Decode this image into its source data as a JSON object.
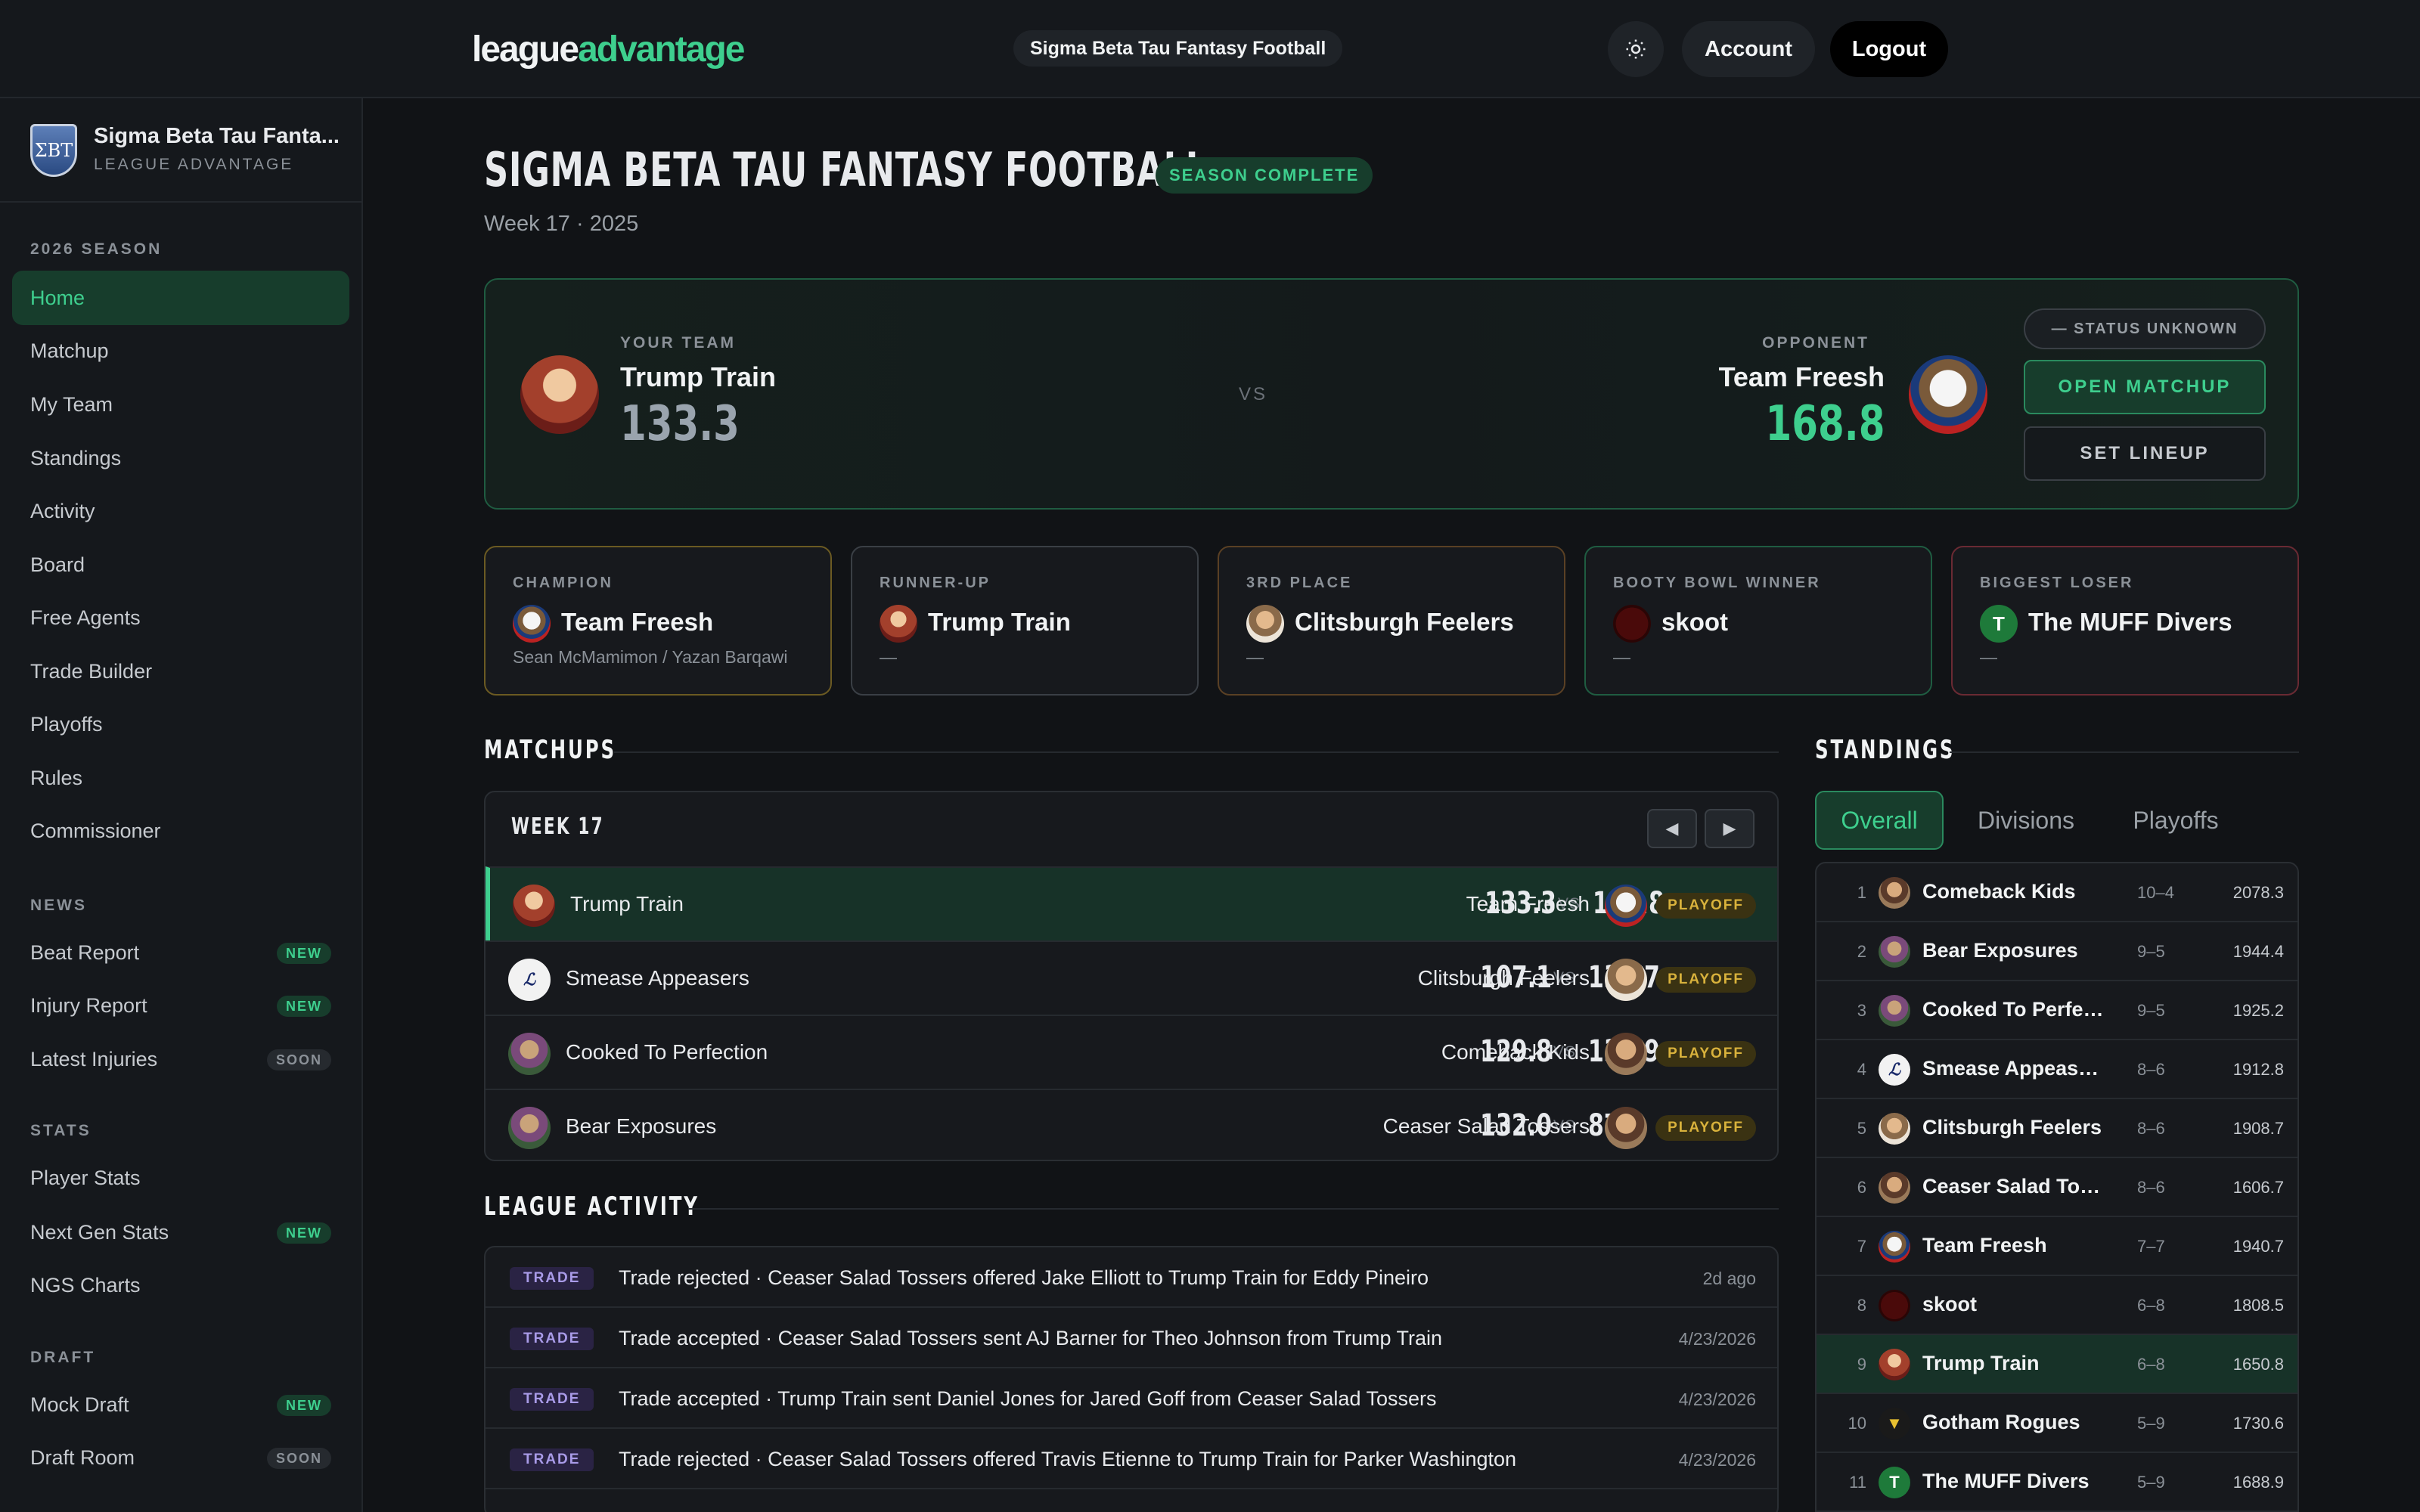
{
  "topbar": {
    "logo_main": "league",
    "logo_accent": "advantage",
    "league_name": "Sigma Beta Tau Fantasy Football",
    "account_label": "Account",
    "logout_label": "Logout"
  },
  "sidebar": {
    "league_name": "Sigma Beta Tau Fanta...",
    "league_sub": "LEAGUE ADVANTAGE",
    "crest_letters": "ΣΒΤ",
    "sections": {
      "season": "2026 SEASON",
      "news": "NEWS",
      "stats": "STATS",
      "draft": "DRAFT"
    },
    "season_items": [
      "Home",
      "Matchup",
      "My Team",
      "Standings",
      "Activity",
      "Board",
      "Free Agents",
      "Trade Builder",
      "Playoffs",
      "Rules",
      "Commissioner"
    ],
    "news_items": [
      {
        "label": "Beat Report",
        "badge": "NEW"
      },
      {
        "label": "Injury Report",
        "badge": "NEW"
      },
      {
        "label": "Latest Injuries",
        "badge": "SOON"
      }
    ],
    "stats_items": [
      {
        "label": "Player Stats",
        "badge": ""
      },
      {
        "label": "Next Gen Stats",
        "badge": "NEW"
      },
      {
        "label": "NGS Charts",
        "badge": ""
      }
    ],
    "draft_items": [
      {
        "label": "Mock Draft",
        "badge": "NEW"
      },
      {
        "label": "Draft Room",
        "badge": "SOON"
      }
    ]
  },
  "header": {
    "title": "SIGMA BETA TAU FANTASY FOOTBALL",
    "status_badge": "SEASON COMPLETE",
    "subtitle": "Week 17 · 2025"
  },
  "hero": {
    "your_label": "YOUR TEAM",
    "your_team": "Trump Train",
    "your_score": "133.3",
    "vs": "VS",
    "opp_label": "OPPONENT",
    "opp_team": "Team Freesh",
    "opp_score": "168.8",
    "status_pill": "— STATUS UNKNOWN",
    "open_matchup": "OPEN MATCHUP",
    "set_lineup": "SET LINEUP"
  },
  "awards": [
    {
      "label": "CHAMPION",
      "team": "Team Freesh",
      "sub": "Sean McMamimon / Yazan Barqawi",
      "color": "#6b5a22"
    },
    {
      "label": "RUNNER-UP",
      "team": "Trump Train",
      "sub": "—",
      "color": "#3a3f45"
    },
    {
      "label": "3RD PLACE",
      "team": "Clitsburgh Feelers",
      "sub": "—",
      "color": "#5a4024"
    },
    {
      "label": "BOOTY BOWL WINNER",
      "team": "skoot",
      "sub": "—",
      "color": "#1f5c41"
    },
    {
      "label": "BIGGEST LOSER",
      "team": "The MUFF Divers",
      "sub": "—",
      "color": "#6a2a33"
    }
  ],
  "matchups": {
    "section_title": "MATCHUPS",
    "week_label": "WEEK 17",
    "rows": [
      {
        "team1": "Trump Train",
        "score1": "133.3",
        "vs": "VS",
        "score2": "168.8",
        "team2": "Team Freesh",
        "badge": "PLAYOFF"
      },
      {
        "team1": "Smease Appeasers",
        "score1": "107.1",
        "vs": "VS",
        "score2": "137.7",
        "team2": "Clitsburgh Feelers",
        "badge": "PLAYOFF"
      },
      {
        "team1": "Cooked To Perfection",
        "score1": "129.8",
        "vs": "VS",
        "score2": "136.9",
        "team2": "Comeback Kids",
        "badge": "PLAYOFF"
      },
      {
        "team1": "Bear Exposures",
        "score1": "132.0",
        "vs": "VS",
        "score2": "87.6",
        "team2": "Ceaser Salad Tossers",
        "badge": "PLAYOFF"
      }
    ]
  },
  "activity": {
    "section_title": "LEAGUE ACTIVITY",
    "rows": [
      {
        "tag": "TRADE",
        "text": "Trade rejected · Ceaser Salad Tossers offered Jake Elliott to Trump Train for Eddy Pineiro",
        "when": "2d ago"
      },
      {
        "tag": "TRADE",
        "text": "Trade accepted · Ceaser Salad Tossers sent AJ Barner for Theo Johnson from Trump Train",
        "when": "4/23/2026"
      },
      {
        "tag": "TRADE",
        "text": "Trade accepted · Trump Train sent Daniel Jones for Jared Goff from Ceaser Salad Tossers",
        "when": "4/23/2026"
      },
      {
        "tag": "TRADE",
        "text": "Trade rejected · Ceaser Salad Tossers offered Travis Etienne to Trump Train for Parker Washington",
        "when": "4/23/2026"
      }
    ]
  },
  "standings": {
    "section_title": "STANDINGS",
    "tabs": [
      "Overall",
      "Divisions",
      "Playoffs"
    ],
    "rows": [
      {
        "rank": "1",
        "team": "Comeback Kids",
        "record": "10–4",
        "points": "2078.3"
      },
      {
        "rank": "2",
        "team": "Bear Exposures",
        "record": "9–5",
        "points": "1944.4"
      },
      {
        "rank": "3",
        "team": "Cooked To Perfec...",
        "record": "9–5",
        "points": "1925.2"
      },
      {
        "rank": "4",
        "team": "Smease Appease...",
        "record": "8–6",
        "points": "1912.8"
      },
      {
        "rank": "5",
        "team": "Clitsburgh Feelers",
        "record": "8–6",
        "points": "1908.7"
      },
      {
        "rank": "6",
        "team": "Ceaser Salad Tos...",
        "record": "8–6",
        "points": "1606.7"
      },
      {
        "rank": "7",
        "team": "Team Freesh",
        "record": "7–7",
        "points": "1940.7"
      },
      {
        "rank": "8",
        "team": "skoot",
        "record": "6–8",
        "points": "1808.5"
      },
      {
        "rank": "9",
        "team": "Trump Train",
        "record": "6–8",
        "points": "1650.8"
      },
      {
        "rank": "10",
        "team": "Gotham Rogues",
        "record": "5–9",
        "points": "1730.6"
      },
      {
        "rank": "11",
        "team": "The MUFF Divers",
        "record": "5–9",
        "points": "1688.9"
      }
    ]
  },
  "avatar_letters": {
    "muff": "T"
  },
  "colors": {
    "accent": "#3ecf8e",
    "background": "#111316",
    "panel": "#17191d",
    "playoff_badge": "#d9b23c",
    "trade_tag": "#a99be8"
  }
}
